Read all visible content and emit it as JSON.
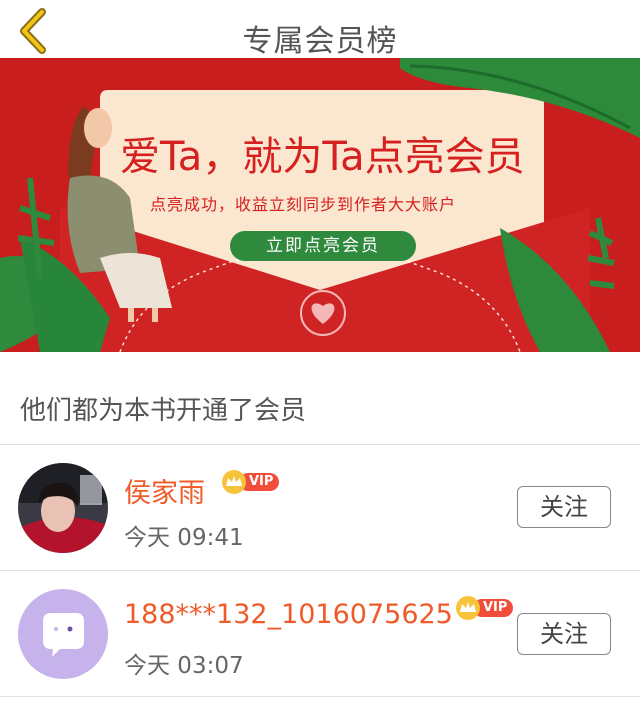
{
  "header": {
    "title": "专属会员榜"
  },
  "banner": {
    "headline": "爱Ta，就为Ta点亮会员",
    "subtitle": "点亮成功，收益立刻同步到作者大大账户",
    "button_label": "立即点亮会员"
  },
  "section": {
    "title": "他们都为本书开通了会员"
  },
  "members": [
    {
      "name": "侯家雨",
      "time": "今天 09:41",
      "badge": "VIP",
      "follow_label": "关注"
    },
    {
      "name": "188***132_1016075625",
      "time": "今天 03:07",
      "badge": "VIP",
      "follow_label": "关注"
    }
  ],
  "colors": {
    "accent": "#f05a28",
    "banner_red": "#c81e1e",
    "button_green": "#2f8a3d",
    "vip_red": "#f04e3a"
  }
}
